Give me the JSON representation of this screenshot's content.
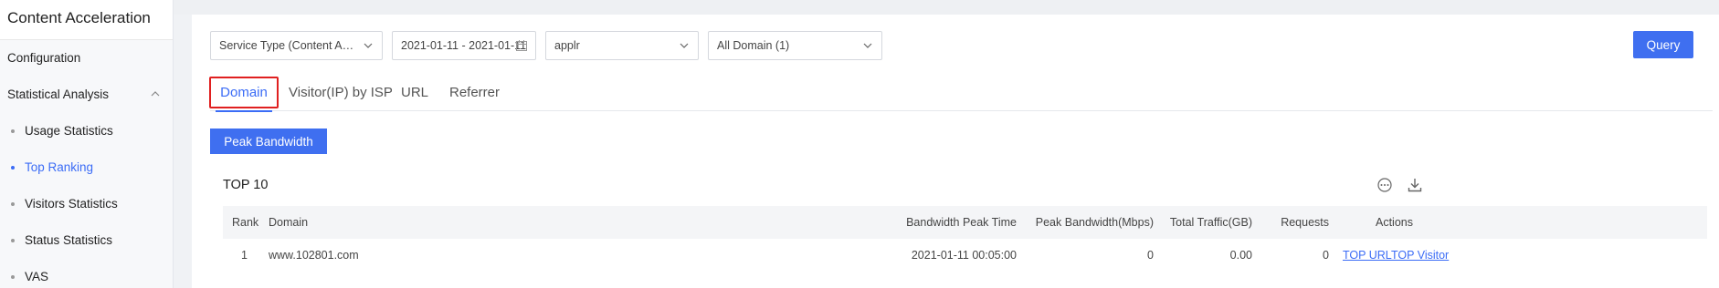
{
  "sidebar": {
    "title": "Content Acceleration",
    "items": [
      {
        "label": "Configuration"
      },
      {
        "label": "Statistical Analysis",
        "expanded": true
      }
    ],
    "subitems": [
      {
        "label": "Usage Statistics",
        "active": false
      },
      {
        "label": "Top Ranking",
        "active": true
      },
      {
        "label": "Visitors Statistics",
        "active": false
      },
      {
        "label": "Status Statistics",
        "active": false
      },
      {
        "label": "VAS",
        "active": false
      }
    ]
  },
  "filters": {
    "service_type": "Service Type (Content Acceleration)",
    "date_range": "2021-01-11 - 2021-01-11",
    "account": "applr",
    "domain_scope": "All Domain (1)"
  },
  "toolbar": {
    "query_label": "Query"
  },
  "tabs": [
    {
      "label": "Domain",
      "active": true
    },
    {
      "label": "Visitor(IP) by ISP",
      "active": false
    },
    {
      "label": "URL",
      "active": false
    },
    {
      "label": "Referrer",
      "active": false
    }
  ],
  "metric_button": "Peak Bandwidth",
  "section_title": "TOP 10",
  "table": {
    "headers": {
      "rank": "Rank",
      "domain": "Domain",
      "peak_time": "Bandwidth Peak Time",
      "peak_bw": "Peak Bandwidth(Mbps)",
      "traffic": "Total Traffic(GB)",
      "requests": "Requests",
      "actions": "Actions"
    },
    "rows": [
      {
        "rank": "1",
        "domain": "www.102801.com",
        "peak_time": "2021-01-11 00:05:00",
        "peak_bw": "0",
        "traffic": "0.00",
        "requests": "0",
        "action1": "TOP URL",
        "action2": "TOP Visitor"
      }
    ]
  },
  "colors": {
    "accent": "#3f6ff0",
    "highlight": "#e02020"
  }
}
